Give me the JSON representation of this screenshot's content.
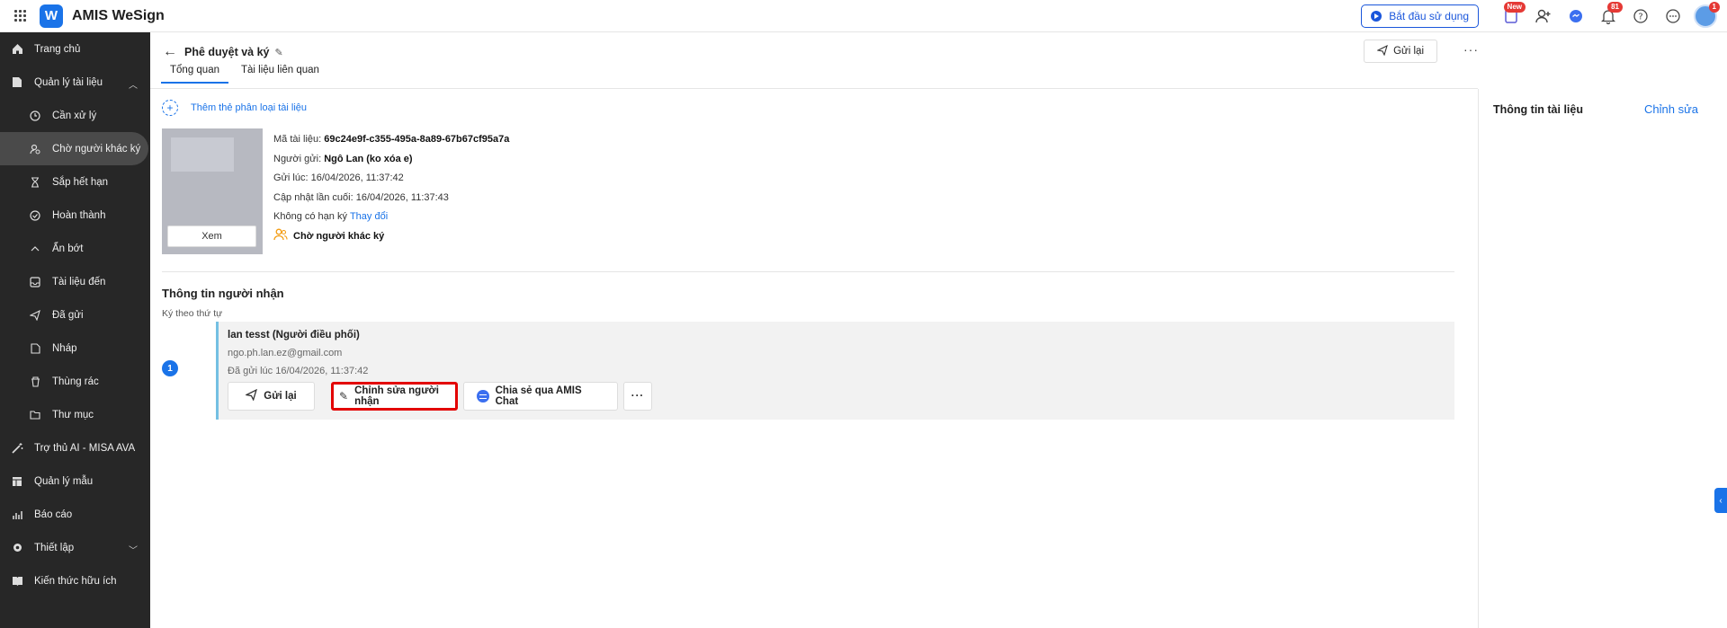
{
  "app": {
    "title": "AMIS WeSign",
    "logo_letter": "W"
  },
  "topbar": {
    "start_label": "Bắt đầu sử dụng",
    "new_badge": "New",
    "notif_count": "81",
    "avatar_badge": "1"
  },
  "sidebar": {
    "items": [
      {
        "label": "Trang chủ",
        "icon": "home-icon"
      },
      {
        "label": "Quản lý tài liệu",
        "icon": "document-icon"
      },
      {
        "label": "Cần xử lý",
        "icon": "clock-icon"
      },
      {
        "label": "Chờ người khác ký",
        "icon": "user-wait-icon"
      },
      {
        "label": "Sắp hết hạn",
        "icon": "hourglass-icon"
      },
      {
        "label": "Hoàn thành",
        "icon": "check-circle-icon"
      },
      {
        "label": "Ẩn bớt",
        "icon": "chevron-up-icon"
      },
      {
        "label": "Tài liệu đến",
        "icon": "inbox-icon"
      },
      {
        "label": "Đã gửi",
        "icon": "send-icon"
      },
      {
        "label": "Nháp",
        "icon": "draft-icon"
      },
      {
        "label": "Thùng rác",
        "icon": "trash-icon"
      },
      {
        "label": "Thư mục",
        "icon": "folder-icon"
      },
      {
        "label": "Trợ thủ AI - MISA AVA",
        "icon": "magic-wand-icon"
      },
      {
        "label": "Quản lý mẫu",
        "icon": "template-icon"
      },
      {
        "label": "Báo cáo",
        "icon": "chart-icon"
      },
      {
        "label": "Thiết lập",
        "icon": "gear-icon"
      },
      {
        "label": "Kiến thức hữu ích",
        "icon": "book-icon"
      }
    ]
  },
  "header": {
    "title": "Phê duyệt và ký",
    "resend_label": "Gửi lại",
    "tabs": [
      "Tổng quan",
      "Tài liệu liên quan"
    ]
  },
  "overview": {
    "add_tag_label": "Thêm thẻ phân loại tài liệu",
    "view_label": "Xem",
    "doc_id_label": "Mã tài liệu:",
    "doc_id": "69c24e9f-c355-495a-8a89-67b67cf95a7a",
    "sender_label": "Người gửi:",
    "sender": "Ngô Lan (ko xóa e)",
    "sent_at_label": "Gửi lúc:",
    "sent_at": "16/04/2026, 11:37:42",
    "updated_label": "Cập nhật lần cuối:",
    "updated_at": "16/04/2026, 11:37:43",
    "deadline_label": "Không có hạn ký",
    "change_label": "Thay đổi",
    "status": "Chờ người khác ký"
  },
  "recipients": {
    "title": "Thông tin người nhận",
    "order_label": "Ký theo thứ tự",
    "list": [
      {
        "step": "1",
        "name": "lan tesst (Người điều phối)",
        "email": "ngo.ph.lan.ez@gmail.com",
        "sent": "Đã gửi lúc 16/04/2026, 11:37:42",
        "actions": {
          "resend": "Gửi lại",
          "edit": "Chỉnh sửa người nhận",
          "share": "Chia sẻ qua AMIS Chat"
        }
      }
    ]
  },
  "right_panel": {
    "title": "Thông tin tài liệu",
    "edit_label": "Chỉnh sửa"
  },
  "colors": {
    "accent": "#1a73e8",
    "sidebar_bg": "#272727",
    "highlight_border": "#e30000",
    "recipient_bar": "#74c0e3"
  }
}
